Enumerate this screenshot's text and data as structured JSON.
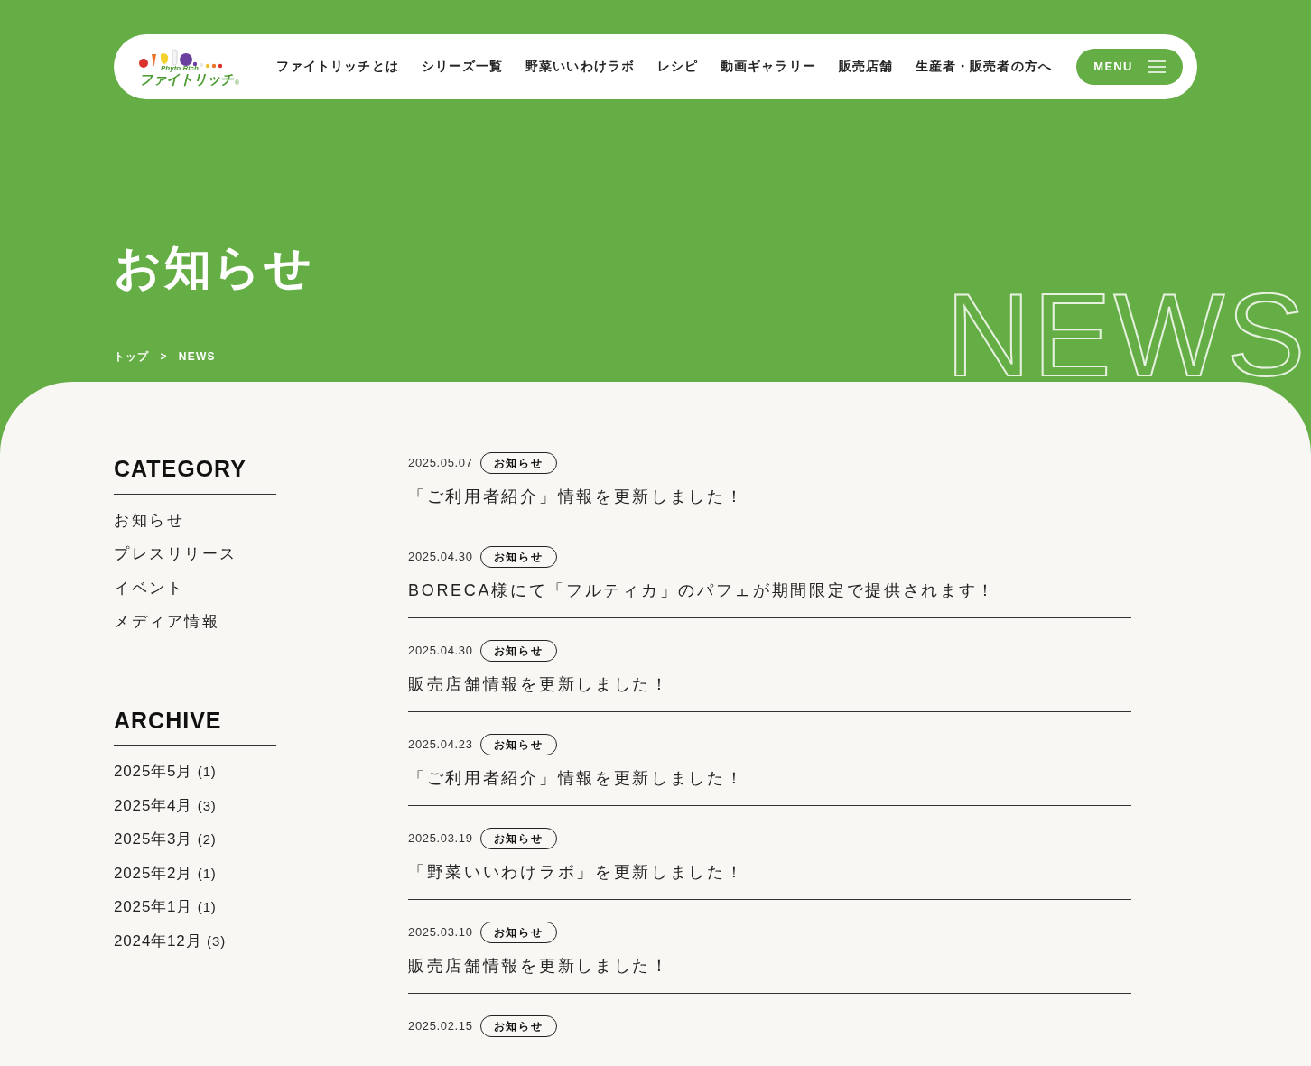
{
  "header": {
    "logo": {
      "tagline": "Phyto Rich",
      "name": "ファイトリッチ",
      "mark": "®"
    },
    "nav": [
      "ファイトリッチとは",
      "シリーズ一覧",
      "野菜いいわけラボ",
      "レシピ",
      "動画ギャラリー",
      "販売店舗",
      "生産者・販売者の方へ"
    ],
    "menu_button": "MENU"
  },
  "hero": {
    "title": "お知らせ",
    "watermark": "NEWS",
    "breadcrumb": [
      "トップ",
      "NEWS"
    ],
    "breadcrumb_separator": ">"
  },
  "sidebar": {
    "category": {
      "heading": "CATEGORY",
      "items": [
        "お知らせ",
        "プレスリリース",
        "イベント",
        "メディア情報"
      ]
    },
    "archive": {
      "heading": "ARCHIVE",
      "items": [
        {
          "label": "2025年5月",
          "count": "(1)"
        },
        {
          "label": "2025年4月",
          "count": "(3)"
        },
        {
          "label": "2025年3月",
          "count": "(2)"
        },
        {
          "label": "2025年2月",
          "count": "(1)"
        },
        {
          "label": "2025年1月",
          "count": "(1)"
        },
        {
          "label": "2024年12月",
          "count": "(3)"
        }
      ]
    }
  },
  "news": [
    {
      "date": "2025.05.07",
      "tag": "お知らせ",
      "title": "「ご利用者紹介」情報を更新しました！"
    },
    {
      "date": "2025.04.30",
      "tag": "お知らせ",
      "title": "BORECA様にて「フルティカ」のパフェが期間限定で提供されます！"
    },
    {
      "date": "2025.04.30",
      "tag": "お知らせ",
      "title": "販売店舗情報を更新しました！"
    },
    {
      "date": "2025.04.23",
      "tag": "お知らせ",
      "title": "「ご利用者紹介」情報を更新しました！"
    },
    {
      "date": "2025.03.19",
      "tag": "お知らせ",
      "title": "「野菜いいわけラボ」を更新しました！"
    },
    {
      "date": "2025.03.10",
      "tag": "お知らせ",
      "title": "販売店舗情報を更新しました！"
    },
    {
      "date": "2025.02.15",
      "tag": "お知らせ"
    }
  ]
}
